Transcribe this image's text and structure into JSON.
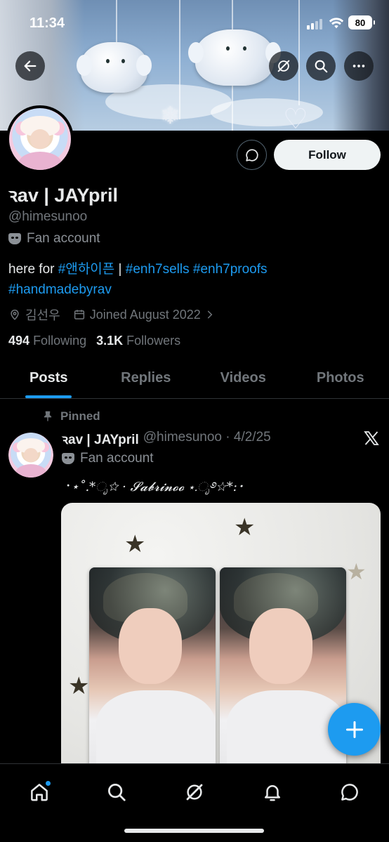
{
  "status_bar": {
    "time": "11:34",
    "battery": "80"
  },
  "profile": {
    "display_name": "ꝛav | JAYpril",
    "handle": "@himesunoo",
    "category": "Fan account",
    "bio": {
      "prefix": "here for ",
      "tag1": "#앤하이픈",
      "sep": " | ",
      "tag2": "#enh7sells",
      "space": " ",
      "tag3": "#enh7proofs",
      "tag4": "#handmadebyrav"
    },
    "location": "김선우",
    "joined": "Joined August 2022",
    "following_count": "494",
    "following_label": "Following",
    "followers_count": "3.1K",
    "followers_label": "Followers"
  },
  "actions": {
    "follow_label": "Follow"
  },
  "tabs": [
    {
      "label": "Posts",
      "active": true
    },
    {
      "label": "Replies",
      "active": false
    },
    {
      "label": "Videos",
      "active": false
    },
    {
      "label": "Photos",
      "active": false
    }
  ],
  "post": {
    "pinned_label": "Pinned",
    "name": "ꝛav | JAYpril",
    "handle_date": "@himesunoo · 4/2/25",
    "category": "Fan account",
    "text": "⠐⋆˚.*ೃ☆ · 𝓢𝓪𝓫𝓻𝓲𝓷𝓸𝓸 ⋆.ೃ࿔☆*:･"
  },
  "icons": {
    "back": "back-arrow-icon",
    "grok": "grok-icon",
    "search": "search-icon",
    "more": "more-icon",
    "message": "message-icon",
    "location": "location-pin-icon",
    "calendar": "calendar-icon",
    "pin": "pin-icon",
    "x_logo": "x-logo-icon",
    "compose": "plus-icon",
    "nav": [
      "home-icon",
      "search-icon",
      "grok-icon",
      "bell-icon",
      "messages-icon"
    ]
  },
  "colors": {
    "accent": "#1d9bf0",
    "background": "#000000",
    "muted": "#71767b",
    "text": "#e7e9ea"
  }
}
